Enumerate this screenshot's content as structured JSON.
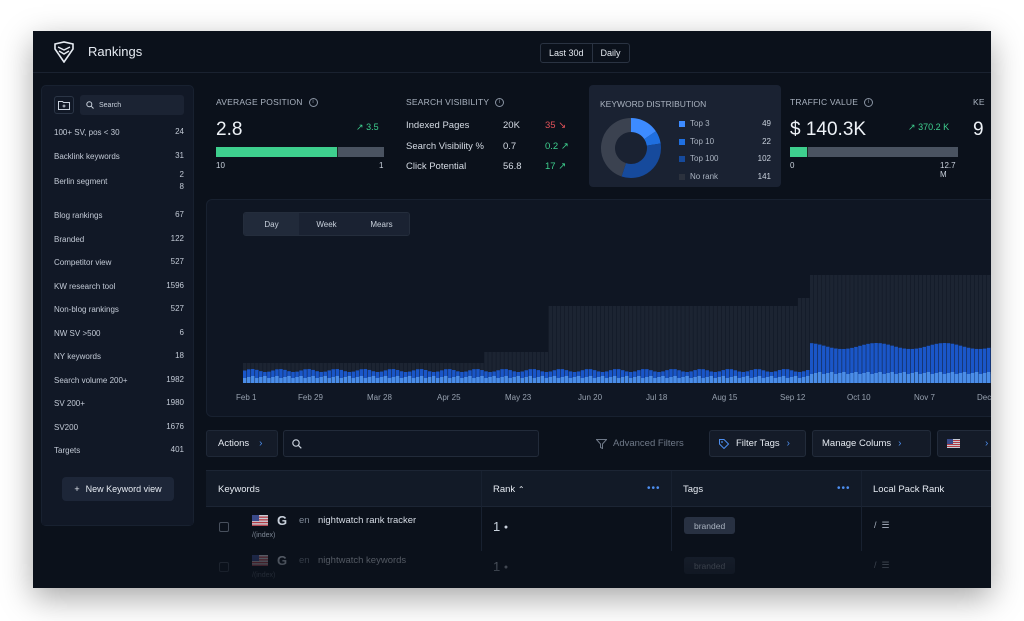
{
  "app": {
    "title": "Rankings",
    "logo_icon": "shield-logo-icon"
  },
  "range": {
    "period": "Last 30d",
    "granularity": "Daily"
  },
  "sidebar": {
    "search_placeholder": "Search",
    "items": [
      {
        "label": "100+ SV, pos < 30",
        "count": "24"
      },
      {
        "label": "Backlink keywords",
        "count": "31"
      },
      {
        "label": "Berlin segment",
        "count": "2\n8"
      },
      {
        "label": "Blog rankings",
        "count": "67"
      },
      {
        "label": "Branded",
        "count": "122"
      },
      {
        "label": "Competitor view",
        "count": "527"
      },
      {
        "label": "KW research tool",
        "count": "1596"
      },
      {
        "label": "Non-blog rankings",
        "count": "527"
      },
      {
        "label": "NW SV >500",
        "count": "6"
      },
      {
        "label": "NY keywords",
        "count": "18"
      },
      {
        "label": "Search volume 200+",
        "count": "1982"
      },
      {
        "label": "SV 200+",
        "count": "1980"
      },
      {
        "label": "SV200",
        "count": "1676"
      },
      {
        "label": "Targets",
        "count": "401"
      }
    ],
    "new_view_label": "New Keyword view"
  },
  "kpis": {
    "avg_position": {
      "label": "AVERAGE POSITION",
      "value": "2.8",
      "delta": "3.5",
      "bar_fraction": 0.72,
      "min": "10",
      "max": "1"
    },
    "visibility": {
      "label": "SEARCH VISIBILITY",
      "rows": [
        {
          "label": "Indexed Pages",
          "value": "20K",
          "delta": "35",
          "delta_dir": "down"
        },
        {
          "label": "Search Visibility %",
          "value": "0.7",
          "delta": "0.2",
          "delta_dir": "up"
        },
        {
          "label": "Click Potential",
          "value": "56.8",
          "delta": "17",
          "delta_dir": "up"
        }
      ]
    },
    "distribution": {
      "label": "KEYWORD DISTRIBUTION",
      "legend": [
        {
          "label": "Top 3",
          "value": "49",
          "color": "#3d8bff"
        },
        {
          "label": "Top 10",
          "value": "22",
          "color": "#1f6fe0"
        },
        {
          "label": "Top 100",
          "value": "102",
          "color": "#164a9c"
        },
        {
          "label": "No rank",
          "value": "141",
          "color": "#3b4250"
        }
      ]
    },
    "traffic": {
      "label": "TRAFFIC VALUE",
      "value": "$ 140.3K",
      "delta": "370.2 K",
      "bar_fraction": 0.1,
      "min": "0",
      "max": "12.7 M"
    },
    "cut": {
      "label": "KE",
      "value": "9"
    }
  },
  "chart": {
    "tabs": [
      "Day",
      "Week",
      "Mears"
    ],
    "active_tab": "Day",
    "x_ticks": [
      "Feb 1",
      "Feb 29",
      "Mar 28",
      "Apr 25",
      "May 23",
      "Jun 20",
      "Jul 18",
      "Aug 15",
      "Sep 12",
      "Oct 10",
      "Nov 7",
      "Dec"
    ]
  },
  "toolbar": {
    "actions_label": "Actions",
    "search_placeholder": "",
    "advanced_filters_label": "Advanced Filters",
    "filter_tags_label": "Filter Tags",
    "manage_columns_label": "Manage Colums"
  },
  "table": {
    "columns": {
      "keywords": "Keywords",
      "rank": "Rank",
      "tags": "Tags",
      "local_pack": "Local Pack Rank"
    },
    "rows": [
      {
        "lang": "en",
        "keyword": "nightwatch rank tracker",
        "indexed": "/(index)",
        "rank": "1",
        "tag": "branded",
        "local": "/"
      },
      {
        "lang": "en",
        "keyword": "nightwatch keywords",
        "indexed": "/(index)",
        "rank": "1",
        "tag": "branded",
        "local": "/"
      }
    ]
  }
}
